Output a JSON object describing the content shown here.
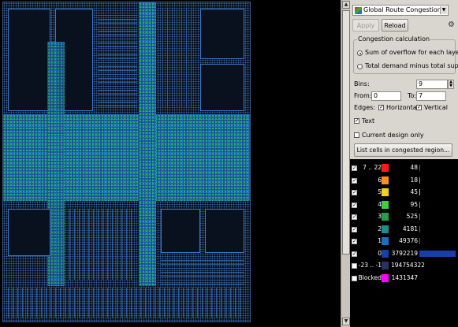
{
  "panel": {
    "layer_select": "Global Route Congestion",
    "apply_label": "Apply",
    "reload_label": "Reload",
    "calc_group_title": "Congestion calculation",
    "option_overflow": "Sum of overflow for each layer",
    "option_demand": "Total demand minus total supply",
    "bins_label": "Bins:",
    "bins_value": "9",
    "from_label": "From:",
    "from_value": "0",
    "to_label": "To:",
    "to_value": "7",
    "edges_label": "Edges:",
    "edge_horizontal": "Horizontal",
    "edge_vertical": "Vertical",
    "text_label": "Text",
    "current_design_label": "Current design only",
    "list_cells_label": "List cells in congested region..."
  },
  "legend": [
    {
      "range": "7 .. 22",
      "count": "48",
      "color": "#ff1a1a",
      "checked": true,
      "fraction": 1e-05
    },
    {
      "range": "6",
      "count": "18",
      "color": "#ff8a1e",
      "checked": true,
      "fraction": 5e-06
    },
    {
      "range": "5",
      "count": "45",
      "color": "#f4d21c",
      "checked": true,
      "fraction": 1e-05
    },
    {
      "range": "4",
      "count": "95",
      "color": "#3ecf3e",
      "checked": true,
      "fraction": 2.5e-05
    },
    {
      "range": "3",
      "count": "525",
      "color": "#21a24a",
      "checked": true,
      "fraction": 0.00014
    },
    {
      "range": "2",
      "count": "4181",
      "color": "#1d8f8a",
      "checked": true,
      "fraction": 0.0011
    },
    {
      "range": "1",
      "count": "49376",
      "color": "#1a6fc0",
      "checked": true,
      "fraction": 0.013
    },
    {
      "range": "0",
      "count": "3792219",
      "color": "#1640a8",
      "checked": true,
      "fraction": 1.0
    },
    {
      "range": "-23 .. -1",
      "count": "194754322",
      "color": "#2a3162",
      "checked": false,
      "fraction": 0
    },
    {
      "range": "Blocked",
      "count": "1431347",
      "color": "#ff00ff",
      "checked": false,
      "fraction": 0
    }
  ]
}
